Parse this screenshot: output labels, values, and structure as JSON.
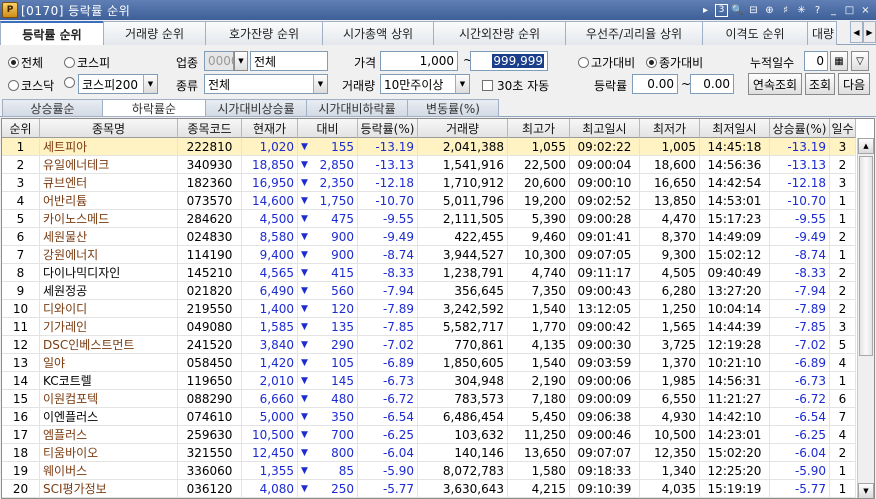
{
  "window": {
    "title": "[0170] 등락률 순위",
    "logo_text": "P",
    "controls": [
      "▸",
      "3",
      "🔍",
      "⊟",
      "⊕",
      "♯",
      "✳",
      "?",
      "_",
      "□",
      "×"
    ]
  },
  "main_tabs": [
    "등락률 순위",
    "거래량 순위",
    "호가잔량 순위",
    "시가총액 상위",
    "시간외잔량 순위",
    "우선주/괴리율 상위",
    "이격도 순위",
    "대량"
  ],
  "filters": {
    "market_all": "전체",
    "market_kospi": "코스피",
    "market_kosdaq": "코스닥",
    "index_select": "코스피200",
    "sector_label": "업종",
    "sector_code": "0000",
    "sector_value": "전체",
    "type_label": "종류",
    "type_value": "전체",
    "price_label": "가격",
    "price_from": "1,000",
    "price_to": "999,999",
    "volume_label": "거래량",
    "volume_value": "10만주이상",
    "auto_label": "30초 자동",
    "basis_high": "고가대비",
    "basis_close": "종가대비",
    "range_label": "등락률",
    "range_from": "0.00",
    "range_sep": "~",
    "range_to": "0.00",
    "days_label": "누적일수",
    "days_value": "0",
    "btn_continuous": "연속조회",
    "btn_query": "조회",
    "btn_next": "다음"
  },
  "sub_tabs": [
    "상승률순",
    "하락률순",
    "시가대비상승률",
    "시가대비하락률",
    "변동률(%)"
  ],
  "table": {
    "headers": [
      "순위",
      "종목명",
      "종목코드",
      "현재가",
      "대비",
      "등락률(%)",
      "거래량",
      "최고가",
      "최고일시",
      "최저가",
      "최저일시",
      "상승률(%)",
      "일수"
    ],
    "rows": [
      [
        "1",
        "세트피아",
        "222810",
        "1,020",
        "155",
        "-13.19",
        "2,041,388",
        "1,055",
        "09:02:22",
        "1,005",
        "14:45:18",
        "-13.19",
        "3"
      ],
      [
        "2",
        "유일에너테크",
        "340930",
        "18,850",
        "2,850",
        "-13.13",
        "1,541,916",
        "22,500",
        "09:00:04",
        "18,600",
        "14:56:36",
        "-13.13",
        "2"
      ],
      [
        "3",
        "큐브엔터",
        "182360",
        "16,950",
        "2,350",
        "-12.18",
        "1,710,912",
        "20,600",
        "09:00:10",
        "16,650",
        "14:42:54",
        "-12.18",
        "3"
      ],
      [
        "4",
        "어반리튬",
        "073570",
        "14,600",
        "1,750",
        "-10.70",
        "5,011,796",
        "19,200",
        "09:02:52",
        "13,850",
        "14:53:01",
        "-10.70",
        "1"
      ],
      [
        "5",
        "카이노스메드",
        "284620",
        "4,500",
        "475",
        "-9.55",
        "2,111,505",
        "5,390",
        "09:00:28",
        "4,470",
        "15:17:23",
        "-9.55",
        "1"
      ],
      [
        "6",
        "세원물산",
        "024830",
        "8,580",
        "900",
        "-9.49",
        "422,455",
        "9,460",
        "09:01:41",
        "8,370",
        "14:49:09",
        "-9.49",
        "2"
      ],
      [
        "7",
        "강원에너지",
        "114190",
        "9,400",
        "900",
        "-8.74",
        "3,944,527",
        "10,300",
        "09:07:05",
        "9,300",
        "15:02:12",
        "-8.74",
        "1"
      ],
      [
        "8",
        "다이나믹디자인",
        "145210",
        "4,565",
        "415",
        "-8.33",
        "1,238,791",
        "4,740",
        "09:11:17",
        "4,505",
        "09:40:49",
        "-8.33",
        "2"
      ],
      [
        "9",
        "세원정공",
        "021820",
        "6,490",
        "560",
        "-7.94",
        "356,645",
        "7,350",
        "09:00:43",
        "6,280",
        "13:27:20",
        "-7.94",
        "2"
      ],
      [
        "10",
        "디와이디",
        "219550",
        "1,400",
        "120",
        "-7.89",
        "3,242,592",
        "1,540",
        "13:12:05",
        "1,250",
        "10:04:14",
        "-7.89",
        "2"
      ],
      [
        "11",
        "기가레인",
        "049080",
        "1,585",
        "135",
        "-7.85",
        "5,582,717",
        "1,770",
        "09:00:42",
        "1,565",
        "14:44:39",
        "-7.85",
        "3"
      ],
      [
        "12",
        "DSC인베스트먼트",
        "241520",
        "3,840",
        "290",
        "-7.02",
        "770,861",
        "4,135",
        "09:00:30",
        "3,725",
        "12:19:28",
        "-7.02",
        "5"
      ],
      [
        "13",
        "일야",
        "058450",
        "1,420",
        "105",
        "-6.89",
        "1,850,605",
        "1,540",
        "09:03:59",
        "1,370",
        "10:21:10",
        "-6.89",
        "4"
      ],
      [
        "14",
        "KC코트렐",
        "119650",
        "2,010",
        "145",
        "-6.73",
        "304,948",
        "2,190",
        "09:00:06",
        "1,985",
        "14:56:31",
        "-6.73",
        "1"
      ],
      [
        "15",
        "이원컴포텍",
        "088290",
        "6,660",
        "480",
        "-6.72",
        "783,573",
        "7,180",
        "09:00:09",
        "6,550",
        "11:21:27",
        "-6.72",
        "6"
      ],
      [
        "16",
        "이엔플러스",
        "074610",
        "5,000",
        "350",
        "-6.54",
        "6,486,454",
        "5,450",
        "09:06:38",
        "4,930",
        "14:42:10",
        "-6.54",
        "7"
      ],
      [
        "17",
        "엠플러스",
        "259630",
        "10,500",
        "700",
        "-6.25",
        "103,632",
        "11,250",
        "09:00:46",
        "10,500",
        "14:23:01",
        "-6.25",
        "4"
      ],
      [
        "18",
        "티움바이오",
        "321550",
        "12,450",
        "800",
        "-6.04",
        "140,146",
        "13,650",
        "09:07:07",
        "12,350",
        "15:02:20",
        "-6.04",
        "2"
      ],
      [
        "19",
        "웨이버스",
        "336060",
        "1,355",
        "85",
        "-5.90",
        "8,072,783",
        "1,580",
        "09:18:33",
        "1,340",
        "12:25:20",
        "-5.90",
        "1"
      ],
      [
        "20",
        "SCI평가정보",
        "036120",
        "4,080",
        "250",
        "-5.77",
        "3,630,643",
        "4,215",
        "09:10:39",
        "4,035",
        "15:19:19",
        "-5.77",
        "1"
      ]
    ],
    "name_colors": [
      "brown",
      "brown",
      "brown",
      "brown",
      "brown",
      "brown",
      "brown",
      "black",
      "black",
      "brown",
      "brown",
      "brown",
      "brown",
      "black",
      "brown",
      "black",
      "brown",
      "brown",
      "brown",
      "brown"
    ],
    "down_arrow": "▼"
  },
  "colors": {
    "accent": "#3a6fc0",
    "down": "#1d2bd0",
    "selected_row": "#fff3c4"
  }
}
